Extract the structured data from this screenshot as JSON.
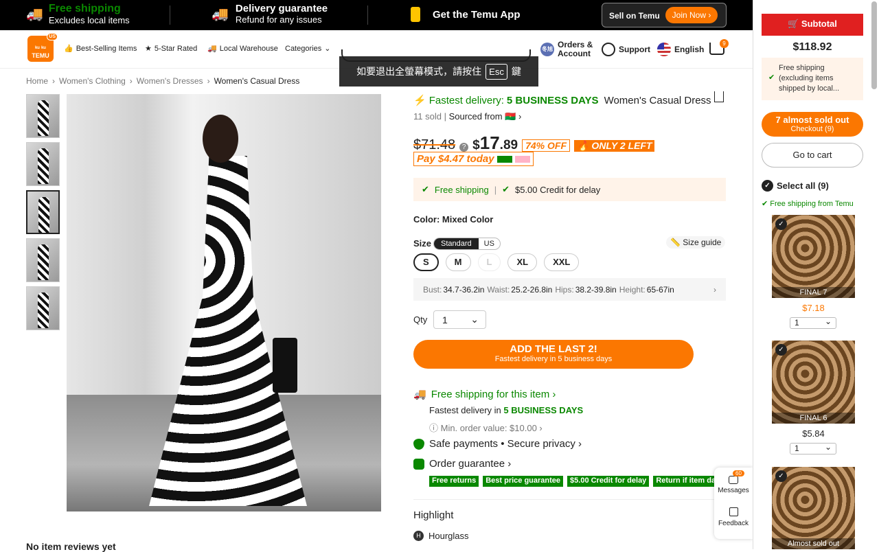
{
  "topbar": {
    "free_shipping_title": "Free shipping",
    "free_shipping_sub": "Excludes local items",
    "delivery_title": "Delivery guarantee",
    "delivery_sub": "Refund for any issues",
    "app_label": "Get the Temu App",
    "sell_label": "Sell on Temu",
    "join_label": "Join Now ›"
  },
  "header": {
    "logo_line1": "ᵏᵘ ᵏᵘ",
    "logo_line2": "TEMU",
    "logo_badge": "US",
    "nav": [
      "Best-Selling Items",
      "5-Star Rated",
      "Local Warehouse",
      "Categories"
    ],
    "esc_prefix": "如要退出全螢幕模式，請按住",
    "esc_key": "Esc",
    "esc_suffix": "鍵",
    "avatar_text": "冬旭",
    "orders_label_1": "Orders &",
    "orders_label_2": "Account",
    "support_label": "Support",
    "language_label": "English",
    "cart_count": "9"
  },
  "breadcrumb": [
    "Home",
    "Women's Clothing",
    "Women's Dresses",
    "Women's Casual Dress"
  ],
  "product": {
    "fast_prefix": "Fastest delivery:",
    "fast_days": "5 BUSINESS DAYS",
    "title": "Women's Casual Dress",
    "sold": "11 sold",
    "sourced": "Sourced from",
    "sourced_flag": "🇧🇫 ›",
    "old_price": "$71.48",
    "price_currency": "$",
    "price_whole": "17",
    "price_cents": ".89",
    "discount": "74% OFF",
    "stock": "ONLY 2 LEFT",
    "pay_today": "Pay $4.47 today",
    "shipping_1": "Free shipping",
    "shipping_2": "$5.00 Credit for delay",
    "color_label": "Color:",
    "color_value": "Mixed Color",
    "size_label": "Size",
    "size_toggle": [
      "Standard",
      "US"
    ],
    "size_guide": "Size guide",
    "sizes": [
      "S",
      "M",
      "L",
      "XL",
      "XXL"
    ],
    "measure": {
      "bust_label": "Bust:",
      "bust": "34.7-36.2in",
      "waist_label": "Waist:",
      "waist": "25.2-26.8in",
      "hips_label": "Hips:",
      "hips": "38.2-39.8in",
      "height_label": "Height:",
      "height": "65-67in"
    },
    "qty_label": "Qty",
    "qty_value": "1",
    "add_btn": "ADD THE LAST 2!",
    "add_btn_sub": "Fastest delivery in 5 business days",
    "free_ship_item": "Free shipping for this item ›",
    "fast_delivery_in": "Fastest delivery in",
    "fast_delivery_days": "5 BUSINESS DAYS",
    "min_order": "ⓘ Min. order value: $10.00 ›",
    "safe_payments": "Safe payments • Secure privacy ›",
    "order_guarantee": "Order guarantee ›",
    "guarantee_tags": [
      "Free returns",
      "Best price guarantee",
      "$5.00 Credit for delay",
      "Return if item damaged"
    ],
    "highlight": "Highlight",
    "highlight_item": "Hourglass",
    "reviews": "No item reviews yet"
  },
  "floating": {
    "messages_label": "Messages",
    "messages_count": "60",
    "feedback_label": "Feedback"
  },
  "cart_sidebar": {
    "subtotal_label": "Subtotal",
    "total": "$118.92",
    "free_ship_text": "Free shipping (excluding items shipped by local...",
    "almost_sold": "7 almost sold out",
    "checkout": "Checkout (9)",
    "go_to_cart": "Go to cart",
    "select_all": "Select all (9)",
    "free_ship_temu": "Free shipping from Temu",
    "items": [
      {
        "flag": "FINAL 7",
        "price": "$7.18",
        "qty": "1"
      },
      {
        "flag": "FINAL 6",
        "price": "$5.84",
        "qty": "1"
      },
      {
        "flag": "Almost sold out",
        "price": "",
        "qty": ""
      }
    ]
  },
  "colors": {
    "accent": "#fb7701",
    "green": "#0a8800",
    "red": "#e02020"
  }
}
